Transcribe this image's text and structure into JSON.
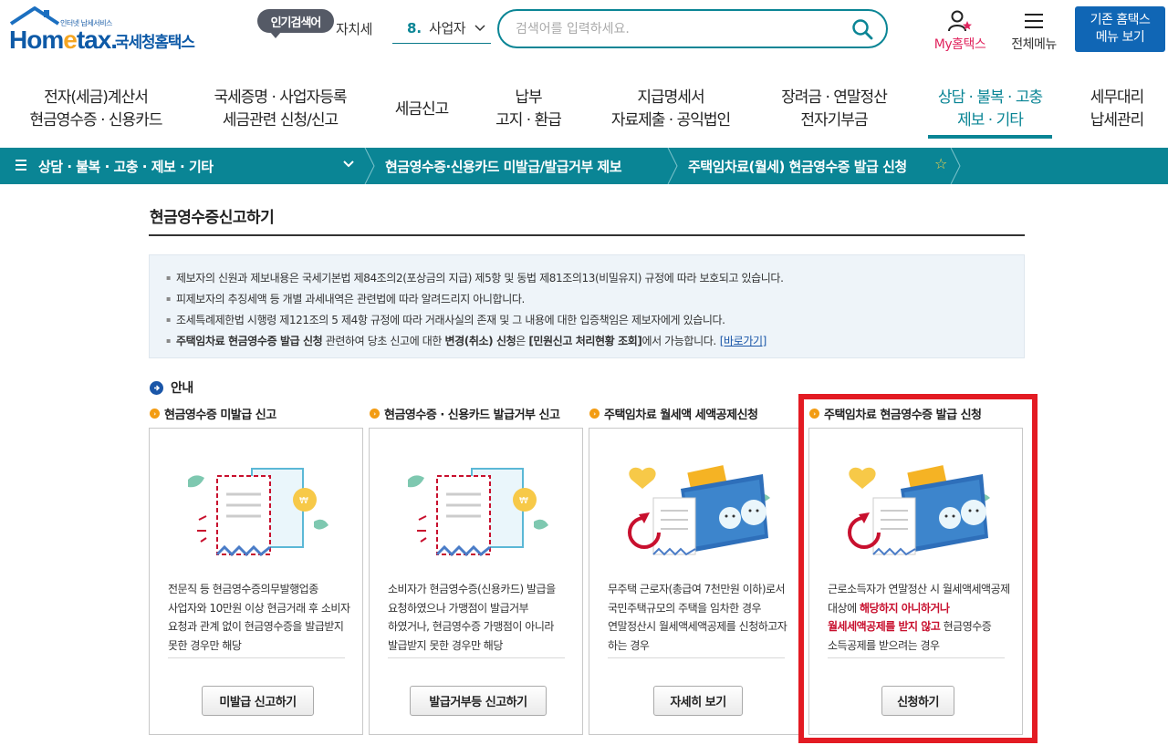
{
  "header": {
    "logo_tagline": "인터넷 납세서비스",
    "logo_brand_1": "Hom",
    "logo_brand_e": "e",
    "logo_brand_2": "tax.",
    "logo_brand_ko": "국세청홈택스",
    "popular_label": "인기검색어",
    "popular_prev": "자치세",
    "popular_rank": "8.",
    "popular_term": "사업자",
    "search_placeholder": "검색어를 입력하세요.",
    "my_label": "My홈택스",
    "menu_label": "전체메뉴",
    "classic_line1": "기존 홈택스",
    "classic_line2": "메뉴 보기"
  },
  "gnb": [
    {
      "line1": "전자(세금)계산서",
      "line2": "현금영수증 · 신용카드"
    },
    {
      "line1": "국세증명 · 사업자등록",
      "line2": "세금관련 신청/신고"
    },
    {
      "line1": "세금신고",
      "line2": ""
    },
    {
      "line1": "납부",
      "line2": "고지 · 환급"
    },
    {
      "line1": "지급명세서",
      "line2": "자료제출 · 공익법인"
    },
    {
      "line1": "장려금 · 연말정산",
      "line2": "전자기부금"
    },
    {
      "line1": "상담 · 불복 · 고충",
      "line2": "제보 · 기타"
    },
    {
      "line1": "세무대리",
      "line2": "납세관리"
    }
  ],
  "breadcrumb": {
    "level1": "상담 · 불복 · 고충 · 제보 · 기타",
    "level2": "현금영수증·신용카드 미발급/발급거부 제보",
    "level3": "주택임차료(월세) 현금영수증 발급 신청"
  },
  "page": {
    "title": "현금영수증신고하기",
    "notice_1": "제보자의 신원과 제보내용은 국세기본법 제84조의2(포상금의 지급) 제5항 및 동법 제81조의13(비밀유지) 규정에 따라 보호되고 있습니다.",
    "notice_2": "피제보자의 추징세액 등 개별 과세내역은 관련법에 따라 알려드리지 아니합니다.",
    "notice_3": "조세특례제한법 시행령 제121조의 5 제4항 규정에 따라 거래사실의 존재 및 그 내용에 대한 입증책임은 제보자에게 있습니다.",
    "notice_4_b1": "주택임차료 현금영수증 발급 신청",
    "notice_4_t1": " 관련하여 당초 신고에 대한 ",
    "notice_4_b2": "변경(취소) 신청",
    "notice_4_t2": "은 ",
    "notice_4_b3": "[민원신고 처리현황 조회]",
    "notice_4_t3": "에서 가능합니다.",
    "notice_4_link": "[바로가기]",
    "guide_label": "안내"
  },
  "cards": [
    {
      "head": "현금영수증 미발급 신고",
      "desc": "전문직 등 현금영수증의무발행업종 사업자와 10만원 이상 현금거래 후 소비자 요청과 관계 없이 현금영수증을 발급받지 못한 경우만 해당",
      "button": "미발급 신고하기"
    },
    {
      "head": "현금영수증 · 신용카드 발급거부 신고",
      "desc": "소비자가 현금영수증(신용카드) 발급을 요청하였으나 가맹점이 발급거부 하였거나, 현금영수증 가맹점이 아니라 발급받지 못한 경우만 해당",
      "button": "발급거부등 신고하기"
    },
    {
      "head": "주택임차료 월세액 세액공제신청",
      "desc": "무주택 근로자(총급여 7천만원 이하)로서 국민주택규모의 주택을 임차한 경우 연말정산시 월세액세액공제를 신청하고자 하는 경우",
      "button": "자세히 보기"
    },
    {
      "head": "주택임차료 현금영수증 발급 신청",
      "desc_1": "근로소득자가 연말정산 시 월세액세액공제 대상에 ",
      "desc_red": "해당하지 아니하거나 월세세액공제를 받지 않고",
      "desc_2": " 현금영수증 소득공제를 받으려는 경우",
      "button": "신청하기"
    }
  ],
  "colors": {
    "brand_blue": "#0e5aa7",
    "teal": "#0a8595",
    "highlight_red": "#e31b23",
    "accent_orange": "#f39c12"
  }
}
